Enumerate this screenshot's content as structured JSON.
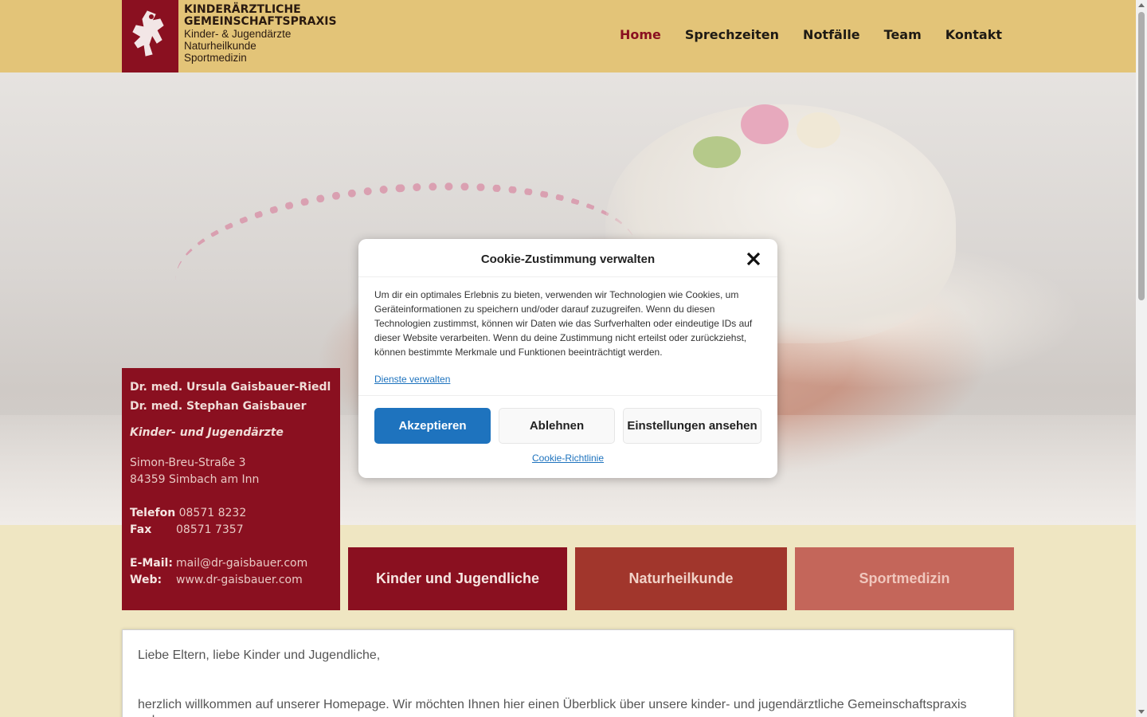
{
  "header": {
    "logo": {
      "line1": "KINDERÄRZTLICHE",
      "line2": "GEMEINSCHAFTSPRAXIS",
      "line3": "Kinder- & Jugendärzte",
      "line4": "Naturheilkunde",
      "line5": "Sportmedizin",
      "icon": "child-figure-icon"
    },
    "nav": [
      {
        "label": "Home",
        "active": true
      },
      {
        "label": "Sprechzeiten",
        "active": false
      },
      {
        "label": "Notfälle",
        "active": false
      },
      {
        "label": "Team",
        "active": false
      },
      {
        "label": "Kontakt",
        "active": false
      }
    ]
  },
  "contact": {
    "doctor1": "Dr. med. Ursula Gaisbauer-Riedl",
    "doctor2": "Dr. med. Stephan Gaisbauer",
    "specialty": "Kinder- und Jugendärzte",
    "street": "Simon-Breu-Straße 3",
    "city": "84359 Simbach am Inn",
    "phone_label": "Telefon",
    "phone": "08571 8232",
    "fax_label": "Fax",
    "fax": "08571 7357",
    "email_label": "E-Mail:",
    "email": "mail@dr-gaisbauer.com",
    "web_label": "Web:",
    "web": "www.dr-gaisbauer.com"
  },
  "tiles": [
    {
      "label": "Kinder und Jugendliche"
    },
    {
      "label": "Naturheilkunde"
    },
    {
      "label": "Sportmedizin"
    }
  ],
  "content": {
    "greeting": "Liebe Eltern, liebe Kinder und Jugendliche,",
    "intro": "herzlich willkommen auf unserer Homepage. Wir möchten Ihnen hier einen Überblick über unsere kinder- und jugendärztliche Gemeinschaftspraxis geben."
  },
  "cookie_modal": {
    "title": "Cookie-Zustimmung verwalten",
    "body": "Um dir ein optimales Erlebnis zu bieten, verwenden wir Technologien wie Cookies, um Geräteinformationen zu speichern und/oder darauf zuzugreifen. Wenn du diesen Technologien zustimmst, können wir Daten wie das Surfverhalten oder eindeutige IDs auf dieser Website verarbeiten. Wenn du deine Zustimmung nicht erteilst oder zurückziehst, können bestimmte Merkmale und Funktionen beeinträchtigt werden.",
    "manage_link": "Dienste verwalten",
    "accept_label": "Akzeptieren",
    "deny_label": "Ablehnen",
    "settings_label": "Einstellungen ansehen",
    "policy_link": "Cookie-Richtlinie",
    "accent_color": "#1e73be"
  },
  "colors": {
    "header_bg": "#e3c478",
    "brand_red": "#8a1020",
    "tile2": "#a1362c",
    "tile3": "#c4665a"
  }
}
